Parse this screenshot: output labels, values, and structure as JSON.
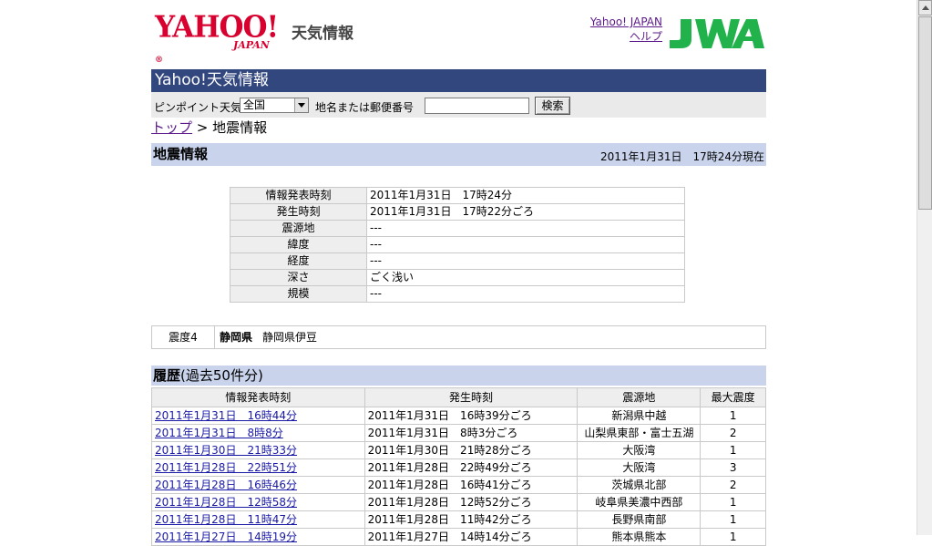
{
  "header": {
    "logo_text": "YAHOO!",
    "logo_reg": "®",
    "logo_japan": "JAPAN",
    "service_name": "天気情報",
    "link_yahoo_japan": "Yahoo! JAPAN",
    "link_help": "ヘルプ",
    "partner_logo": "JWA"
  },
  "titlebar": {
    "title": "Yahoo!天気情報"
  },
  "search": {
    "pinpoint_label": "ピンポイント天気",
    "region_selected": "全国",
    "place_label": "地名または郵便番号",
    "input_value": "",
    "button_label": "検索"
  },
  "breadcrumb": {
    "top": "トップ",
    "separator": ">",
    "current": "地震情報"
  },
  "section": {
    "title": "地震情報",
    "updated": "2011年1月31日　17時24分現在"
  },
  "info": [
    {
      "key": "情報発表時刻",
      "value": "2011年1月31日　17時24分"
    },
    {
      "key": "発生時刻",
      "value": "2011年1月31日　17時22分ごろ"
    },
    {
      "key": "震源地",
      "value": "---"
    },
    {
      "key": "緯度",
      "value": "---"
    },
    {
      "key": "経度",
      "value": "---"
    },
    {
      "key": "深さ",
      "value": "ごく浅い"
    },
    {
      "key": "規模",
      "value": "---"
    }
  ],
  "intensity": {
    "level": "震度4",
    "prefecture": "静岡県",
    "area": "静岡県伊豆"
  },
  "history": {
    "title": "履歴",
    "subtitle": "(過去50件分)",
    "columns": [
      "情報発表時刻",
      "発生時刻",
      "震源地",
      "最大震度"
    ],
    "rows": [
      [
        "2011年1月31日　16時44分",
        "2011年1月31日　16時39分ごろ",
        "新潟県中越",
        "1"
      ],
      [
        "2011年1月31日　8時8分",
        "2011年1月31日　8時3分ごろ",
        "山梨県東部・富士五湖",
        "2"
      ],
      [
        "2011年1月30日　21時33分",
        "2011年1月30日　21時28分ごろ",
        "大阪湾",
        "1"
      ],
      [
        "2011年1月28日　22時51分",
        "2011年1月28日　22時49分ごろ",
        "大阪湾",
        "3"
      ],
      [
        "2011年1月28日　16時46分",
        "2011年1月28日　16時41分ごろ",
        "茨城県北部",
        "2"
      ],
      [
        "2011年1月28日　12時58分",
        "2011年1月28日　12時52分ごろ",
        "岐阜県美濃中西部",
        "1"
      ],
      [
        "2011年1月28日　11時47分",
        "2011年1月28日　11時42分ごろ",
        "長野県南部",
        "1"
      ],
      [
        "2011年1月27日　14時19分",
        "2011年1月27日　14時14分ごろ",
        "熊本県熊本",
        "1"
      ]
    ]
  },
  "colors": {
    "title_bar": "#33477f",
    "section_bar": "#c9d4ec",
    "logo_red": "#d7002f",
    "jwa_green": "#22b24c"
  }
}
